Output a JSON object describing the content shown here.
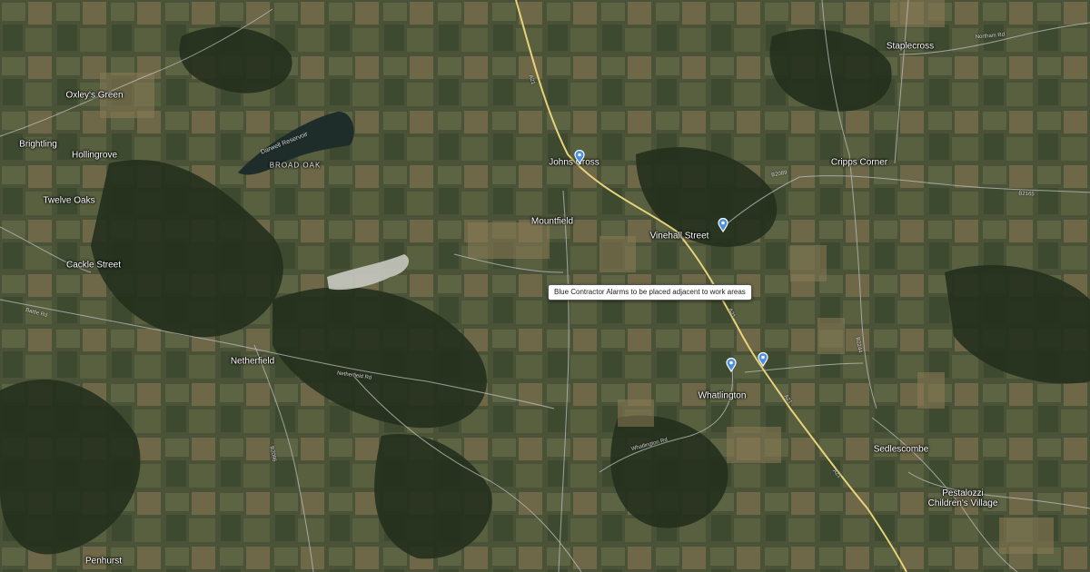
{
  "map": {
    "tooltip": "Blue Contractor Alarms to be placed adjacent to work areas",
    "places": {
      "staplecross": "Staplecross",
      "oxleys_green": "Oxley's Green",
      "brightling": "Brightling",
      "hollingrove": "Hollingrove",
      "twelve_oaks": "Twelve Oaks",
      "cackle_street": "Cackle Street",
      "netherfield": "Netherfield",
      "penhurst": "Penhurst",
      "broad_oak": "BROAD OAK",
      "darwell_reservoir": "Darwell Reservoir",
      "johns_cross": "Johns Cross",
      "mountfield": "Mountfield",
      "vinehall_street": "Vinehall Street",
      "cripps_corner": "Cripps Corner",
      "whatlington": "Whatlington",
      "sedlescombe": "Sedlescombe",
      "pestalozzi": "Pestalozzi Children's Village"
    },
    "roads": {
      "a21_north": "A21",
      "a21_mid": "A21",
      "a21_south": "A21",
      "a21_bottom": "A21",
      "b2244": "B2244",
      "b2165": "B2165",
      "b2089": "B2089",
      "b2096": "B2096",
      "battle_rd": "Battle Rd",
      "netherfield_rd": "Netherfield Rd",
      "northam_rd": "Northam Rd",
      "whatlington_rd": "Whatlington Rd"
    },
    "markers": [
      {
        "name": "marker-johns-cross",
        "color": "#4a90e2"
      },
      {
        "name": "marker-vinehall-street",
        "color": "#4a90e2"
      },
      {
        "name": "marker-whatlington-west",
        "color": "#4a90e2"
      },
      {
        "name": "marker-whatlington-east",
        "color": "#4a90e2"
      }
    ],
    "colors": {
      "marker": "#4a90e2",
      "a_road": "#e8d27a",
      "minor_road": "#bfc2c0"
    }
  }
}
